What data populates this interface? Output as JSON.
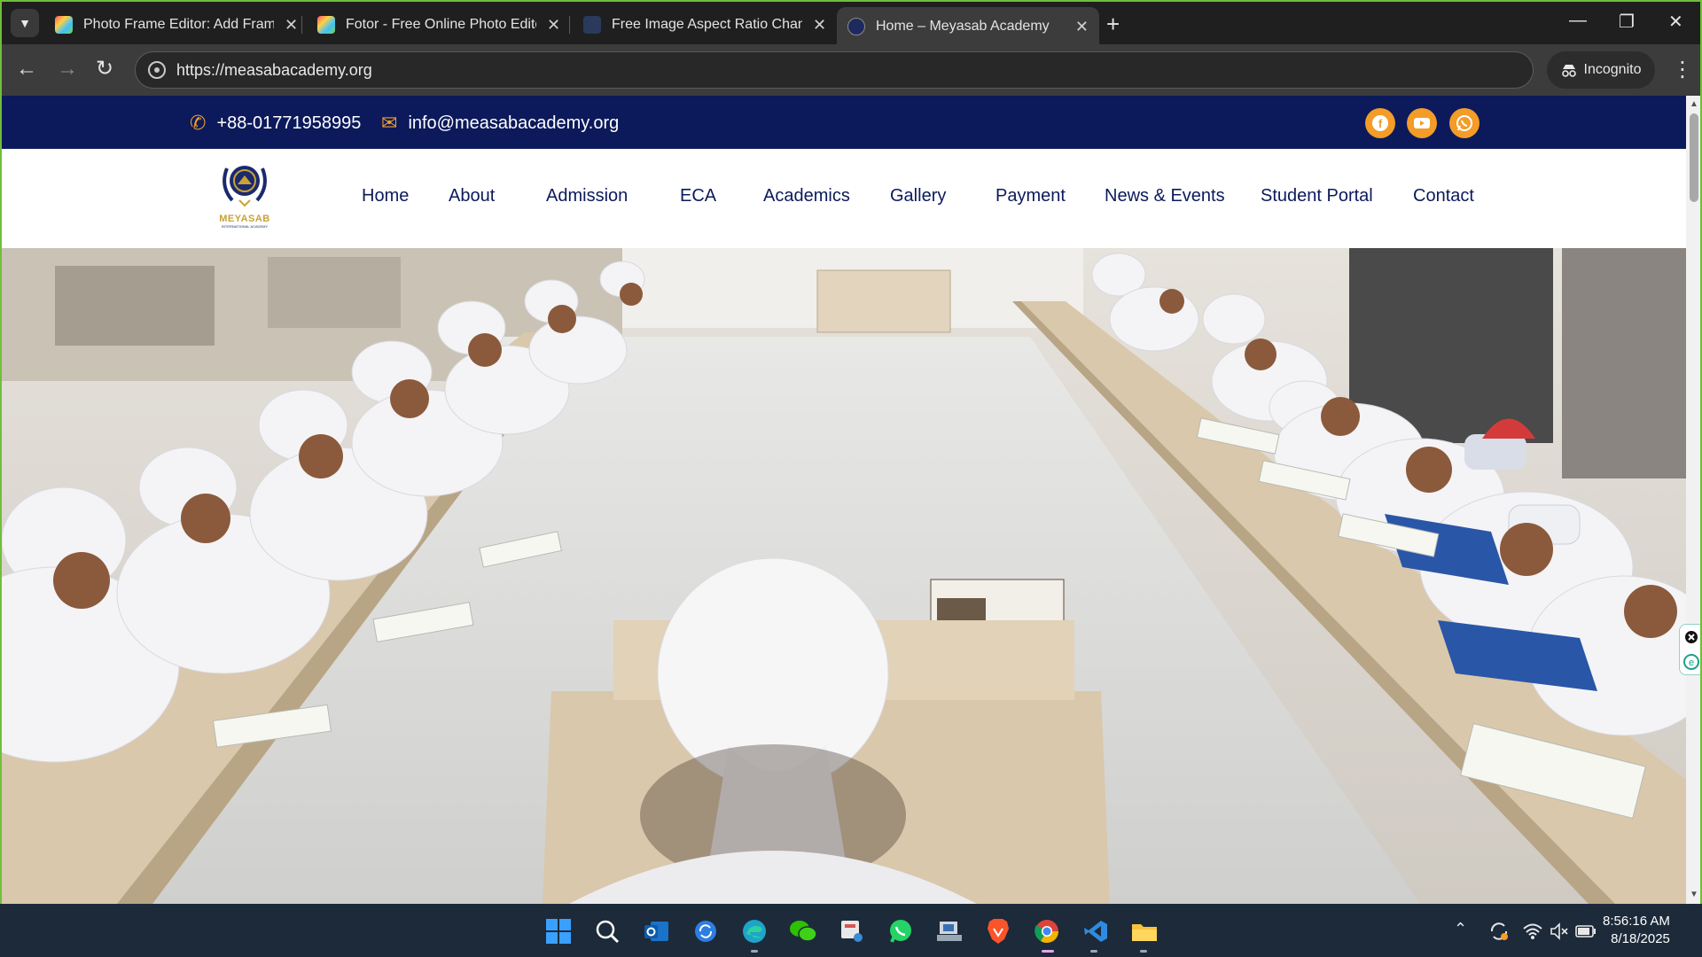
{
  "browser": {
    "tabs": [
      {
        "title": "Photo Frame Editor: Add Frame",
        "favicon_color": "#e9b23b"
      },
      {
        "title": "Fotor - Free Online Photo Edito",
        "favicon_color": "#ffb000"
      },
      {
        "title": "Free Image Aspect Ratio Chang",
        "favicon_color": "#2b3a5c"
      },
      {
        "title": "Home – Meyasab Academy",
        "favicon_color": "#1d2a5e"
      }
    ],
    "active_tab_index": 3,
    "url": "https://measabacademy.org",
    "incognito_label": "Incognito"
  },
  "site": {
    "phone": "+88-01771958995",
    "email": "info@measabacademy.org",
    "social": [
      "facebook-icon",
      "youtube-icon",
      "whatsapp-icon"
    ],
    "logo": {
      "name": "MEYASAB",
      "sub": "INTERNATIONAL ACADEMY"
    },
    "nav": [
      "Home",
      "About",
      "Admission",
      "ECA",
      "Academics",
      "Gallery",
      "Payment",
      "News & Events",
      "Student Portal",
      "Contact"
    ],
    "colors": {
      "topbar": "#0c1a5b",
      "accent": "#f39c27",
      "nav_text": "#0c1a5b"
    }
  },
  "taskbar": {
    "apps": [
      "windows-start-icon",
      "search-icon",
      "outlook-icon",
      "sync-icon",
      "edge-icon",
      "wechat-icon",
      "snipping-tool-icon",
      "whatsapp-icon",
      "network-app-icon",
      "brave-icon",
      "chrome-icon",
      "vscode-icon",
      "file-explorer-icon"
    ],
    "time": "8:56:16 AM",
    "date": "8/18/2025"
  }
}
